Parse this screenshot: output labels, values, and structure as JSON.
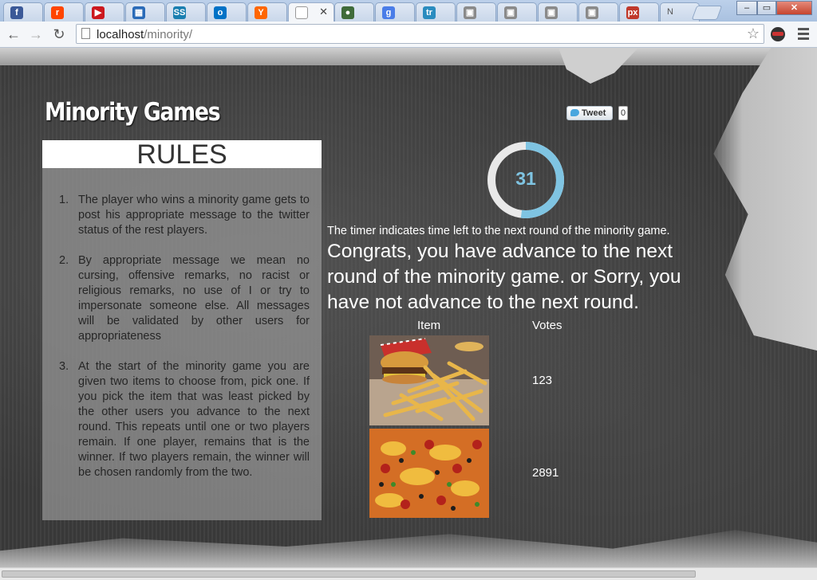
{
  "browser": {
    "tabs": [
      {
        "icon": "facebook-icon",
        "glyph": "f",
        "color": "#3b5998"
      },
      {
        "icon": "reddit-icon",
        "glyph": "r",
        "color": "#ff4500"
      },
      {
        "icon": "youtube-icon",
        "glyph": "▶",
        "color": "#cc181e"
      },
      {
        "icon": "film-icon",
        "glyph": "▦",
        "color": "#2a6bb8"
      },
      {
        "icon": "ss-icon",
        "glyph": "SS",
        "color": "#1a7fb0"
      },
      {
        "icon": "outlook-icon",
        "glyph": "o",
        "color": "#0072c6"
      },
      {
        "icon": "ycombinator-icon",
        "glyph": "Y",
        "color": "#ff6600"
      },
      {
        "icon": "page-icon",
        "glyph": "",
        "color": "#ffffff",
        "active": true
      },
      {
        "icon": "green-app-icon",
        "glyph": "●",
        "color": "#3f6b3a"
      },
      {
        "icon": "google-icon",
        "glyph": "g",
        "color": "#4a7de8"
      },
      {
        "icon": "trello-icon",
        "glyph": "tr",
        "color": "#2a8cbf"
      },
      {
        "icon": "toolkit-icon",
        "glyph": "▣",
        "color": "#8a8a8a"
      },
      {
        "icon": "toolkit-icon",
        "glyph": "▣",
        "color": "#8a8a8a"
      },
      {
        "icon": "toolkit-icon",
        "glyph": "▣",
        "color": "#8a8a8a"
      },
      {
        "icon": "toolkit-icon",
        "glyph": "▣",
        "color": "#8a8a8a"
      },
      {
        "icon": "500px-icon",
        "glyph": "px",
        "color": "#c0392b"
      }
    ],
    "last_tab_label": "N",
    "url_host": "localhost",
    "url_path": "/minority/",
    "win_min": "–",
    "win_max": "▭",
    "win_close": "✕",
    "active_tab_close": "✕"
  },
  "page": {
    "site_title": "Minority Games",
    "tweet_label": "Tweet",
    "tweet_count": "0",
    "rules_title": "RULES",
    "rules": [
      {
        "num": "1.",
        "text": "The player who wins a minority game gets to post his appropriate message to the twitter status of the rest players."
      },
      {
        "num": "2.",
        "text": "By appropriate message we mean no cursing, offensive remarks, no racist or religious remarks, no use of I or try to impersonate someone else. All messages will be validated by other users for appropriateness"
      },
      {
        "num": "3.",
        "text": "At the start of the minority game you are given two items to choose from, pick one. If you pick the item that was least picked by the other users you advance to the next round. This repeats until one or two players remain. If one player, remains that is the winner. If two players remain, the winner will be chosen randomly from the two."
      }
    ],
    "timer_value": "31",
    "timer_fraction_remaining": 0.52,
    "timer_color": "#7fc4e2",
    "timer_note": "The timer indicates time left to the next round of the minority game.",
    "result_message": "Congrats, you have advance to the next round of the minority game. or Sorry, you have not advance to the next round.",
    "table_header_item": "Item",
    "table_header_votes": "Votes",
    "items": [
      {
        "name": "burger-and-fries-image",
        "votes": "123"
      },
      {
        "name": "pizza-image",
        "votes": "2891"
      }
    ]
  }
}
